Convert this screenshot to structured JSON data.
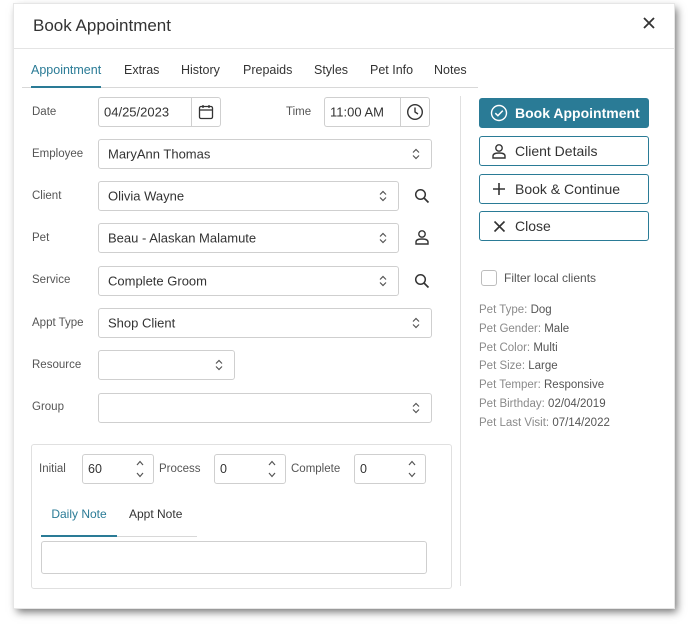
{
  "dialog": {
    "title": "Book Appointment"
  },
  "tabs": [
    "Appointment",
    "Extras",
    "History",
    "Prepaids",
    "Styles",
    "Pet Info",
    "Notes"
  ],
  "form": {
    "date": {
      "label": "Date",
      "value": "04/25/2023"
    },
    "time": {
      "label": "Time",
      "value": "11:00 AM"
    },
    "employee": {
      "label": "Employee",
      "value": "MaryAnn Thomas"
    },
    "client": {
      "label": "Client",
      "value": "Olivia Wayne"
    },
    "pet": {
      "label": "Pet",
      "value": "Beau - Alaskan Malamute"
    },
    "service": {
      "label": "Service",
      "value": "Complete Groom"
    },
    "appt_type": {
      "label": "Appt Type",
      "value": "Shop Client"
    },
    "resource": {
      "label": "Resource",
      "value": ""
    },
    "group": {
      "label": "Group",
      "value": ""
    }
  },
  "durations": {
    "initial": {
      "label": "Initial",
      "value": "60"
    },
    "process": {
      "label": "Process",
      "value": "0"
    },
    "complete": {
      "label": "Complete",
      "value": "0"
    }
  },
  "note_tabs": [
    "Daily Note",
    "Appt Note"
  ],
  "actions": {
    "book": "Book Appointment",
    "client_details": "Client Details",
    "book_continue": "Book & Continue",
    "close": "Close"
  },
  "filter_label": "Filter local clients",
  "pet_info": [
    {
      "key": "Pet Type:",
      "value": "Dog"
    },
    {
      "key": "Pet Gender:",
      "value": "Male"
    },
    {
      "key": "Pet Color:",
      "value": "Multi"
    },
    {
      "key": "Pet Size:",
      "value": "Large"
    },
    {
      "key": "Pet Temper:",
      "value": "Responsive"
    },
    {
      "key": "Pet Birthday:",
      "value": "02/04/2019"
    },
    {
      "key": "Pet Last Visit:",
      "value": "07/14/2022"
    }
  ],
  "colors": {
    "accent": "#2a7b96",
    "border": "#cfcfcf",
    "text": "#333333"
  },
  "icons": [
    "close-icon",
    "calendar-icon",
    "clock-icon",
    "chevron-updown-icon",
    "search-icon",
    "person-icon",
    "check-circle-icon",
    "plus-icon"
  ]
}
